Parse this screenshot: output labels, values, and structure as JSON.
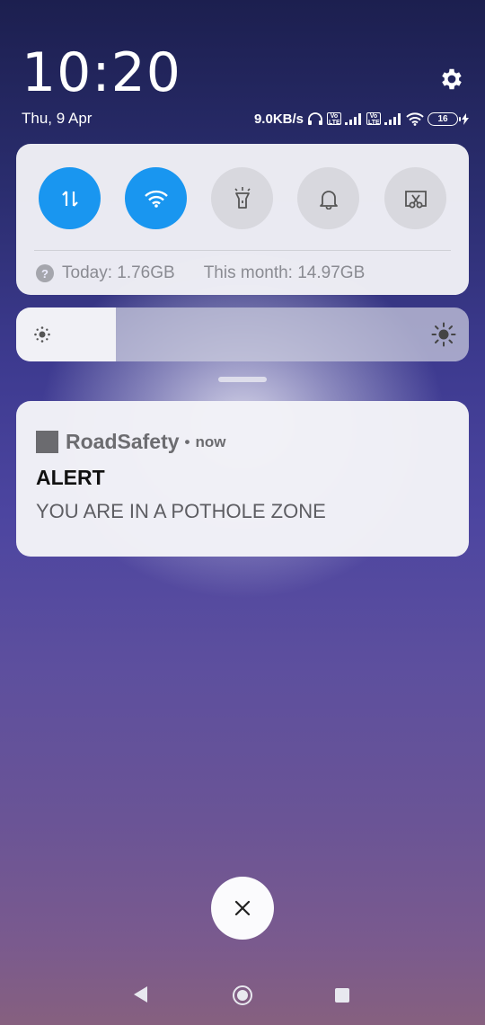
{
  "status": {
    "time": "10:20",
    "date": "Thu, 9 Apr",
    "net_speed": "9.0KB/s",
    "volte_label": "Vo LTE",
    "battery": "16"
  },
  "quick_settings": {
    "tiles": [
      {
        "name": "mobile-data",
        "state": "on"
      },
      {
        "name": "wifi",
        "state": "on"
      },
      {
        "name": "flashlight",
        "state": "off"
      },
      {
        "name": "silent",
        "state": "off"
      },
      {
        "name": "screenshot",
        "state": "off"
      }
    ],
    "data_today": "Today: 1.76GB",
    "data_month": "This month: 14.97GB"
  },
  "brightness": {
    "level_fraction": 0.22
  },
  "notification": {
    "app_name": "RoadSafety",
    "separator": "•",
    "time": "now",
    "title": "ALERT",
    "body": "YOU ARE IN A POTHOLE ZONE"
  },
  "colors": {
    "accent": "#1996f0",
    "tile_off": "#d8d8de",
    "card": "#f2f2f7"
  }
}
